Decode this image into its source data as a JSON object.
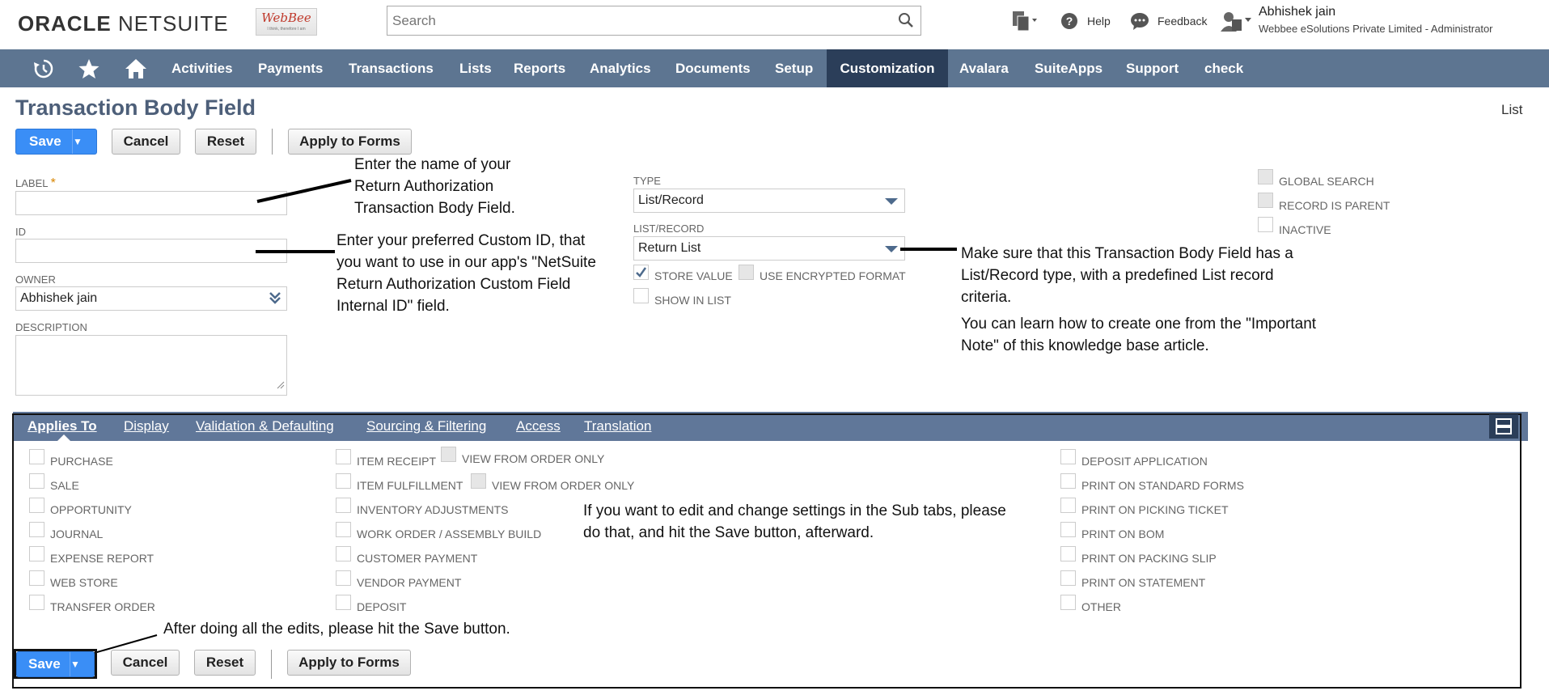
{
  "header": {
    "logo_oracle": "ORACLE",
    "logo_netsuite": "NETSUITE",
    "webbee_logo": "WebBee",
    "webbee_tagline": "I think, therefore I am",
    "search_placeholder": "Search",
    "help": "Help",
    "feedback": "Feedback",
    "user_name": "Abhishek jain",
    "user_role": "Webbee eSolutions Private Limited - Administrator"
  },
  "nav": {
    "items": [
      "Activities",
      "Payments",
      "Transactions",
      "Lists",
      "Reports",
      "Analytics",
      "Documents",
      "Setup",
      "Customization",
      "Avalara",
      "SuiteApps",
      "Support",
      "check"
    ],
    "active": "Customization"
  },
  "page": {
    "title": "Transaction Body Field",
    "list_link": "List"
  },
  "buttons": {
    "save": "Save",
    "cancel": "Cancel",
    "reset": "Reset",
    "apply_to_forms": "Apply to Forms",
    "dropdown_arrow": "▼"
  },
  "fields": {
    "label": "LABEL",
    "required": "*",
    "id": "ID",
    "owner": "OWNER",
    "owner_value": "Abhishek  jain",
    "description": "DESCRIPTION",
    "type": "TYPE",
    "type_value": "List/Record",
    "list_record": "LIST/RECORD",
    "list_record_value": "Return List",
    "store_value": "STORE VALUE",
    "use_encrypted_format": "USE ENCRYPTED FORMAT",
    "show_in_list": "SHOW IN LIST",
    "global_search": "GLOBAL SEARCH",
    "record_is_parent": "RECORD IS PARENT",
    "inactive": "INACTIVE"
  },
  "notes": {
    "label_note_1": "Enter the name of your",
    "label_note_2": "Return Authorization",
    "label_note_3": "Transaction Body Field.",
    "id_note_1": "Enter your preferred Custom ID, that",
    "id_note_2": "you want to use in our app's \"NetSuite",
    "id_note_3": "Return Authorization Custom Field",
    "id_note_4": "Internal ID\" field.",
    "list_note_1": "Make sure that this Transaction Body Field has a",
    "list_note_2": "List/Record type, with a predefined List record",
    "list_note_3": "criteria.",
    "list_note_4": "You can learn how to create one from the \"Important",
    "list_note_5": "Note\" of this knowledge base article.",
    "subtab_note_1": "If you want to edit and change settings in the Sub tabs, please",
    "subtab_note_2": "do that, and hit the Save button, afterward.",
    "save_note": "After doing all the edits, please hit the Save button."
  },
  "subtabs": [
    "Applies To",
    "Display",
    "Validation & Defaulting",
    "Sourcing & Filtering",
    "Access",
    "Translation"
  ],
  "applies_to": {
    "col1": [
      "PURCHASE",
      "SALE",
      "OPPORTUNITY",
      "JOURNAL",
      "EXPENSE REPORT",
      "WEB STORE",
      "TRANSFER ORDER"
    ],
    "col2": [
      "ITEM RECEIPT",
      "ITEM FULFILLMENT",
      "INVENTORY ADJUSTMENTS",
      "WORK ORDER / ASSEMBLY BUILD",
      "CUSTOMER PAYMENT",
      "VENDOR PAYMENT",
      "DEPOSIT"
    ],
    "view_from_order_only": "VIEW FROM ORDER ONLY",
    "col3": [
      "DEPOSIT APPLICATION",
      "PRINT ON STANDARD FORMS",
      "PRINT ON PICKING TICKET",
      "PRINT ON BOM",
      "PRINT ON PACKING SLIP",
      "PRINT ON STATEMENT",
      "OTHER"
    ]
  }
}
